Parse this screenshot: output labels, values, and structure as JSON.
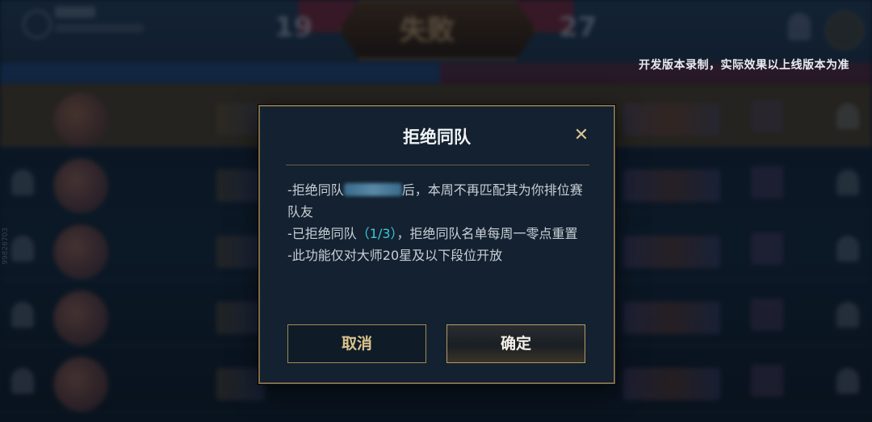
{
  "background": {
    "result": "失败",
    "score_left": "19",
    "score_right": "27",
    "side_id": "99826703"
  },
  "overlay_notice": "开发版本录制，实际效果以上线版本为准",
  "dialog": {
    "title": "拒绝同队",
    "close_icon": "close-icon",
    "line1_prefix": "-拒绝同队",
    "line1_suffix": "后，本周不再匹配其为你排位赛队友",
    "line2_prefix": "-已拒绝同队",
    "line2_count": "（1/3）",
    "line2_suffix": "，拒绝同队名单每周一零点重置",
    "line3": "-此功能仅对大师20星及以下段位开放",
    "cancel_label": "取消",
    "confirm_label": "确定"
  },
  "colors": {
    "accent_gold": "#d9c38e",
    "count_cyan": "#3ec8d8",
    "dialog_bg": "#132130"
  }
}
